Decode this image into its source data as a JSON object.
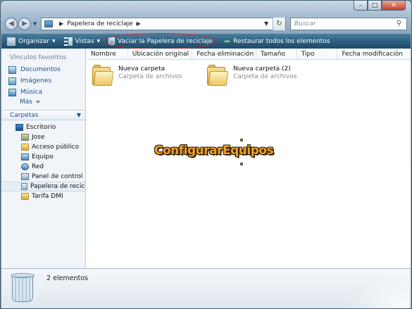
{
  "window": {
    "controls": {
      "minimize": "–",
      "maximize": "□",
      "close": "✕"
    }
  },
  "address": {
    "location": "Papelera de reciclaje",
    "search_placeholder": "Buscar"
  },
  "toolbar": {
    "organize": "Organizar",
    "views": "Vistas",
    "empty_bin": "Vaciar la Papelera de reciclaje",
    "restore_all": "Restaurar todos los elementos"
  },
  "navpane": {
    "favorites_heading": "Vínculos favoritos",
    "favorites": [
      {
        "label": "Documentos",
        "icon": "documents-icon"
      },
      {
        "label": "Imágenes",
        "icon": "pictures-icon"
      },
      {
        "label": "Música",
        "icon": "music-icon"
      }
    ],
    "more": "Más",
    "more_glyph": "»",
    "folders_heading": "Carpetas",
    "tree": [
      {
        "label": "Escritorio",
        "level": 0,
        "icon": "desktop-icon"
      },
      {
        "label": "Jose",
        "level": 1,
        "icon": "user-folder-icon"
      },
      {
        "label": "Acceso público",
        "level": 1,
        "icon": "folder-icon"
      },
      {
        "label": "Equipo",
        "level": 1,
        "icon": "computer-icon"
      },
      {
        "label": "Red",
        "level": 1,
        "icon": "network-icon"
      },
      {
        "label": "Panel de control",
        "level": 1,
        "icon": "control-panel-icon"
      },
      {
        "label": "Papelera de reciclaje",
        "level": 1,
        "icon": "recycle-bin-icon",
        "selected": true
      },
      {
        "label": "Tarifa DMI",
        "level": 1,
        "icon": "folder-icon"
      }
    ]
  },
  "columns": [
    "Nombre",
    "Ubicación original",
    "Fecha eliminación",
    "Tamaño",
    "Tipo",
    "Fecha modificación"
  ],
  "items": [
    {
      "name": "Nueva carpeta",
      "type": "Carpeta de archivos"
    },
    {
      "name": "Nueva carpeta (2)",
      "type": "Carpeta de archivos"
    }
  ],
  "watermark": "ConfigurarEquipos",
  "details": {
    "count": "2 elementos"
  },
  "colors": {
    "toolbar": "#2d5f80",
    "link": "#1e4f8d",
    "highlight_ring": "#d8262b",
    "watermark": "#f0a224"
  }
}
